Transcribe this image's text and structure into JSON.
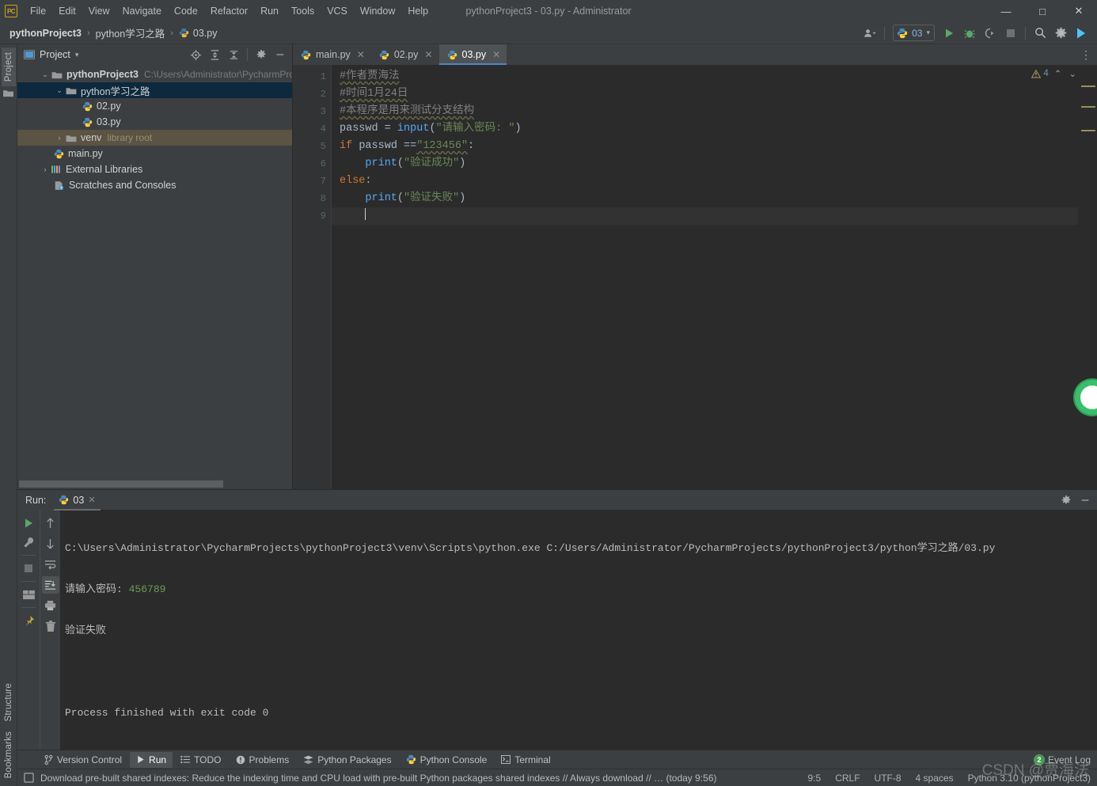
{
  "window": {
    "title": "pythonProject3 - 03.py - Administrator",
    "minimize": "—",
    "maximize": "□",
    "close": "✕"
  },
  "menubar": [
    {
      "label": "File"
    },
    {
      "label": "Edit"
    },
    {
      "label": "View"
    },
    {
      "label": "Navigate"
    },
    {
      "label": "Code"
    },
    {
      "label": "Refactor"
    },
    {
      "label": "Run"
    },
    {
      "label": "Tools"
    },
    {
      "label": "VCS"
    },
    {
      "label": "Window"
    },
    {
      "label": "Help"
    }
  ],
  "breadcrumb": {
    "project": "pythonProject3",
    "folder": "python学习之路",
    "file": "03.py",
    "separator": "›"
  },
  "toolbar": {
    "run_config_name": "03",
    "dropdown_caret": "▾",
    "icons": [
      "user-avatar-icon",
      "run-icon",
      "debug-icon",
      "coverage-icon",
      "stop-icon",
      "search-icon",
      "settings-icon",
      "updates-icon"
    ]
  },
  "left_strip": {
    "project_tab": "Project",
    "structure_tab": "Structure",
    "bookmarks_tab": "Bookmarks"
  },
  "project_panel": {
    "title": "Project",
    "caret": "▾",
    "toolbar_icons": [
      "locate-icon",
      "expand-all-icon",
      "collapse-all-icon",
      "settings-icon",
      "hide-icon"
    ],
    "tree": [
      {
        "label": "pythonProject3",
        "sub": "C:\\Users\\Administrator\\PycharmPro",
        "icon": "folder-icon",
        "arrow": "⌄",
        "depth": 0,
        "bold": true,
        "state": "normal"
      },
      {
        "label": "python学习之路",
        "sub": "",
        "icon": "folder-icon",
        "arrow": "⌄",
        "depth": 1,
        "bold": false,
        "state": "selected"
      },
      {
        "label": "02.py",
        "sub": "",
        "icon": "python-file-icon",
        "arrow": "",
        "depth": 2,
        "bold": false,
        "state": "normal"
      },
      {
        "label": "03.py",
        "sub": "",
        "icon": "python-file-icon",
        "arrow": "",
        "depth": 2,
        "bold": false,
        "state": "normal"
      },
      {
        "label": "venv",
        "sub": "library root",
        "icon": "folder-icon",
        "arrow": "›",
        "depth": 1,
        "bold": false,
        "state": "highlight"
      },
      {
        "label": "main.py",
        "sub": "",
        "icon": "python-file-icon",
        "arrow": "",
        "depth": 1,
        "bold": false,
        "state": "normal"
      },
      {
        "label": "External Libraries",
        "sub": "",
        "icon": "library-icon",
        "arrow": "›",
        "depth": 0,
        "bold": false,
        "state": "normal"
      },
      {
        "label": "Scratches and Consoles",
        "sub": "",
        "icon": "scratch-icon",
        "arrow": "",
        "depth": 0,
        "bold": false,
        "state": "normal"
      }
    ]
  },
  "editor": {
    "tabs": [
      {
        "label": "main.py",
        "active": false,
        "close": "✕"
      },
      {
        "label": "02.py",
        "active": false,
        "close": "✕"
      },
      {
        "label": "03.py",
        "active": true,
        "close": "✕"
      }
    ],
    "inspection": {
      "warning_count": "4",
      "up": "⌃",
      "down": "⌄"
    },
    "line_numbers": [
      "1",
      "2",
      "3",
      "4",
      "5",
      "6",
      "7",
      "8",
      "9"
    ],
    "lines": [
      {
        "n": 1,
        "text": "#作者贾海法"
      },
      {
        "n": 2,
        "text": "#时间1月24日"
      },
      {
        "n": 3,
        "text": "#本程序是用来测试分支结构"
      },
      {
        "n": 4,
        "text": "passwd = input(\"请输入密码: \")"
      },
      {
        "n": 5,
        "text": "if passwd ==\"123456\":"
      },
      {
        "n": 6,
        "text": "    print(\"验证成功\")"
      },
      {
        "n": 7,
        "text": "else:"
      },
      {
        "n": 8,
        "text": "    print(\"验证失败\")"
      },
      {
        "n": 9,
        "text": ""
      }
    ],
    "tokens": {
      "comment1": "#作者贾海法",
      "comment2": "#时间1月24日",
      "comment3": "#本程序是用来测试分支结构",
      "var_passwd": "passwd",
      "eq": " = ",
      "fn_input": "input",
      "paren_open": "(",
      "str_prompt": "\"请输入密码: \"",
      "paren_close": ")",
      "kw_if": "if",
      "cmp": " ==",
      "str_pw": "\"123456\"",
      "colon": ":",
      "fn_print": "print",
      "str_ok": "\"验证成功\"",
      "kw_else": "else",
      "str_fail": "\"验证失败\""
    }
  },
  "run_window": {
    "label": "Run:",
    "tab_name": "03",
    "tab_close": "✕",
    "header_icons": [
      "settings-icon",
      "hide-icon"
    ],
    "side_icons": [
      "rerun-icon",
      "wrench-icon",
      "stop-icon",
      "layout-icon",
      "pin-icon"
    ],
    "side_icons2": [
      "up-arrow-icon",
      "down-arrow-icon",
      "soft-wrap-icon",
      "scroll-to-end-icon",
      "print-icon",
      "trash-icon"
    ],
    "console": [
      {
        "text": "C:\\Users\\Administrator\\PycharmProjects\\pythonProject3\\venv\\Scripts\\python.exe C:/Users/Administrator/PycharmProjects/pythonProject3/python学习之路/03.py",
        "type": "plain"
      },
      {
        "prompt": "请输入密码: ",
        "input": "456789",
        "type": "input"
      },
      {
        "text": "验证失败",
        "type": "plain"
      },
      {
        "text": "",
        "type": "plain"
      },
      {
        "text": "Process finished with exit code 0",
        "type": "plain"
      }
    ]
  },
  "bottom_tabs": [
    {
      "label": "Version Control",
      "icon": "branch-icon",
      "active": false
    },
    {
      "label": "Run",
      "icon": "run-icon",
      "active": true
    },
    {
      "label": "TODO",
      "icon": "todo-icon",
      "active": false
    },
    {
      "label": "Problems",
      "icon": "problems-icon",
      "active": false
    },
    {
      "label": "Python Packages",
      "icon": "packages-icon",
      "active": false
    },
    {
      "label": "Python Console",
      "icon": "python-icon",
      "active": false
    },
    {
      "label": "Terminal",
      "icon": "terminal-icon",
      "active": false
    }
  ],
  "event_log": {
    "label": "Event Log",
    "count": "2"
  },
  "statusbar": {
    "message": "Download pre-built shared indexes: Reduce the indexing time and CPU load with pre-built Python packages shared indexes // Always download // … (today 9:56)",
    "caret_position": "9:5",
    "line_separator": "CRLF",
    "encoding": "UTF-8",
    "indent": "4 spaces",
    "interpreter": "Python 3.10 (pythonProject3)"
  },
  "watermark": "CSDN @贾海法",
  "colors": {
    "bg_chrome": "#3c3f41",
    "bg_editor": "#2b2b2b",
    "accent_tab": "#4a88c7",
    "selection": "#0d293e",
    "highlight_row": "#5b5343",
    "keyword": "#cc7832",
    "string": "#6a8759",
    "function": "#56a8f5",
    "comment": "#808080",
    "badge_green": "#499c54"
  }
}
